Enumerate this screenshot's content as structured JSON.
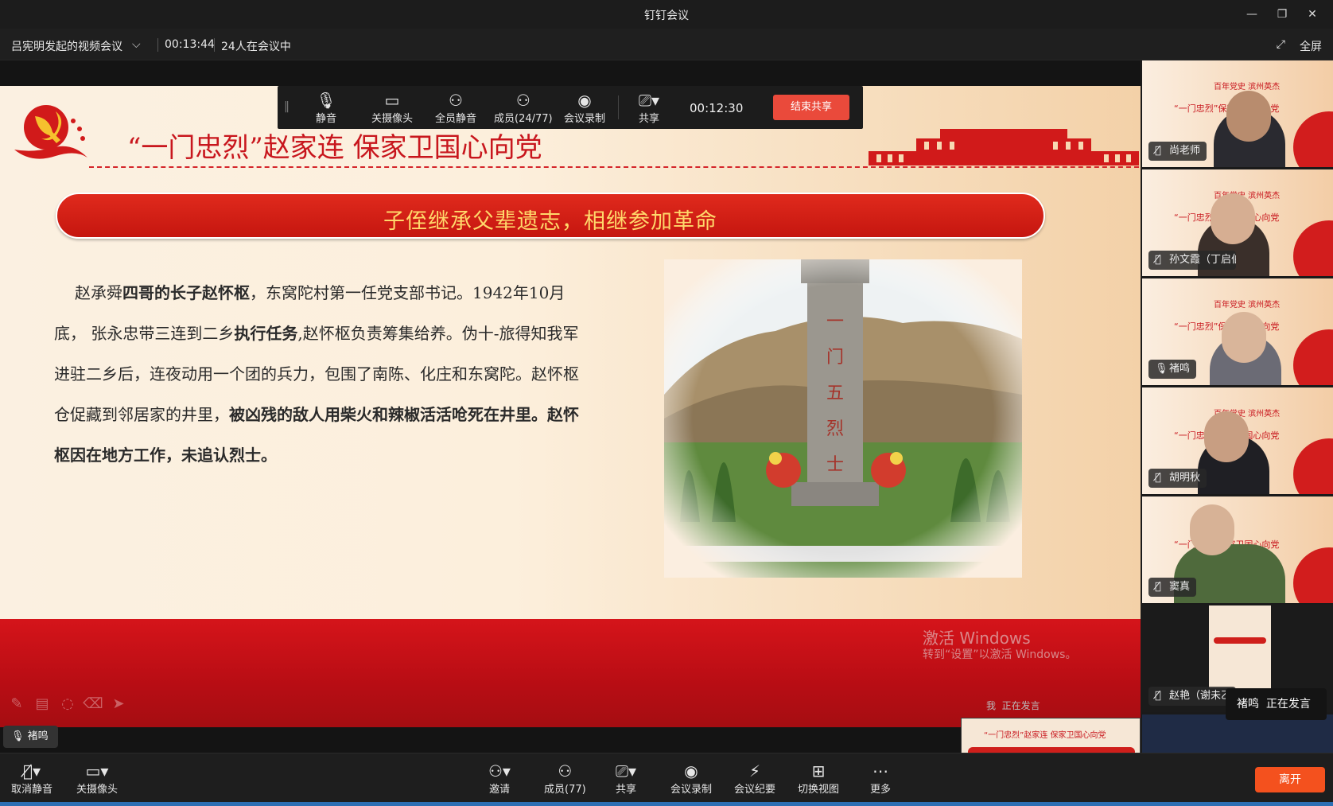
{
  "window": {
    "title": "钉钉会议"
  },
  "info": {
    "meeting_name": "吕宪明发起的视频会议",
    "elapsed": "00:13:44",
    "participants_in_meeting": "24人在会议中",
    "fullscreen_label": "全屏"
  },
  "share_toolbar": {
    "mute": "静音",
    "camera_off": "关摄像头",
    "mute_all": "全员静音",
    "members": "成员(24/77)",
    "record": "会议录制",
    "share": "共享",
    "timer": "00:12:30",
    "end_share": "结束共享"
  },
  "slide": {
    "heading": "“一门忠烈”赵家连 保家卫国心向党",
    "banner": "子侄继承父辈遗志，相继参加革命",
    "paragraph": [
      {
        "text": "赵承舜",
        "bold": false
      },
      {
        "text": "四哥的长子赵怀枢",
        "bold": true
      },
      {
        "text": "，东窝陀村第一任党支部书记。1942年10月底， 张永忠带三连到二乡",
        "bold": false
      },
      {
        "text": "执行任务",
        "bold": true
      },
      {
        "text": ",赵怀枢负责筹集给养。伪十-旅得知我军进驻二乡后，连夜动用一个团的兵力，包围了南陈、化庄和东窝陀。赵怀枢仓促藏到邻居家的井里，",
        "bold": false
      },
      {
        "text": "被凶残的敌人用柴火和辣椒活活呛死在井里。赵怀枢因在地方工作，未追认烈士。",
        "bold": true
      }
    ],
    "monument_text": "一门五烈士"
  },
  "watermark": {
    "line1": "激活 Windows",
    "line2": "转到“设置”以激活 Windows。"
  },
  "self_view": {
    "label": "我",
    "status": "正在发言"
  },
  "current_speaker_tag": "褚鸣",
  "participants": [
    {
      "name": "尚老师",
      "active": false
    },
    {
      "name": "孙文霞（丁启伯",
      "active": false
    },
    {
      "name": "褚鸣",
      "active": true
    },
    {
      "name": "胡明秋",
      "active": false
    },
    {
      "name": "窦真",
      "active": false
    },
    {
      "name": "赵艳（谢未乙",
      "active": false
    }
  ],
  "tile_slide_text": {
    "top": "百年党史 滨州英杰",
    "title": "“一门忠烈”保家卫国心向党"
  },
  "speaking_popup": {
    "name": "褚鸣",
    "status": "正在发言"
  },
  "bottom_bar": {
    "unmute": "取消静音",
    "camera_off": "关摄像头",
    "invite": "邀请",
    "members": "成员(77)",
    "share": "共享",
    "record": "会议录制",
    "minutes": "会议纪要",
    "switch_view": "切换视图",
    "more": "更多",
    "leave": "离开"
  },
  "colors": {
    "accent_red": "#c8161d",
    "leave_orange": "#f4511e",
    "end_share_red": "#ea4a3b",
    "active_green": "#46c46b"
  }
}
